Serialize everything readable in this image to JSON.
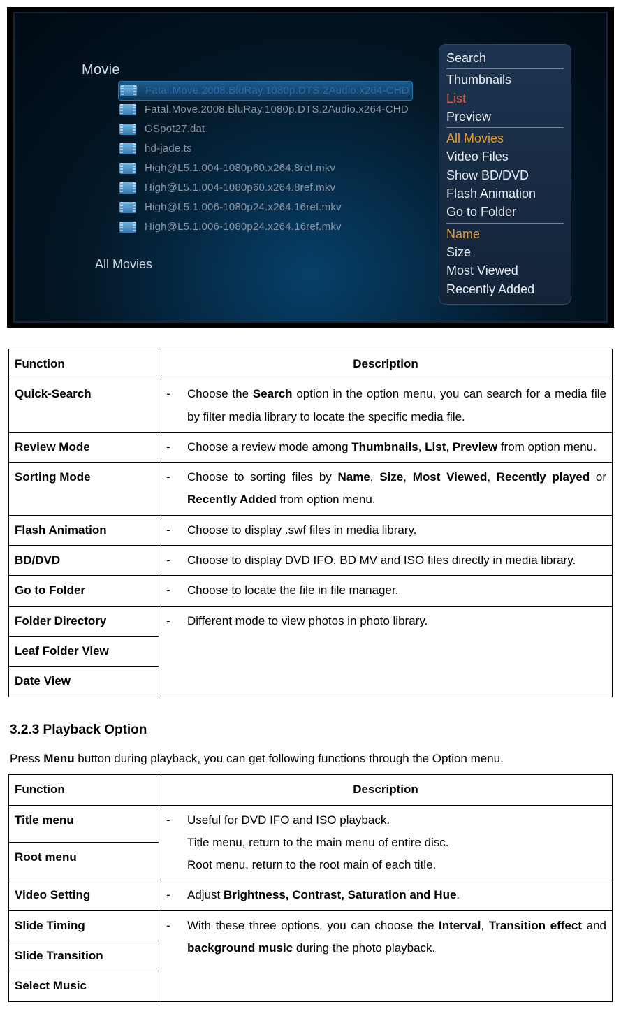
{
  "screenshot": {
    "section_label": "Movie",
    "status_label": "All Movies",
    "files": [
      {
        "name": "Fatal.Move.2008.BluRay.1080p.DTS.2Audio.x264-CHD",
        "selected": true
      },
      {
        "name": "Fatal.Move.2008.BluRay.1080p.DTS.2Audio.x264-CHD",
        "selected": false
      },
      {
        "name": "GSpot27.dat",
        "selected": false
      },
      {
        "name": "hd-jade.ts",
        "selected": false
      },
      {
        "name": "High@L5.1.004-1080p60.x264.8ref.mkv",
        "selected": false
      },
      {
        "name": "High@L5.1.004-1080p60.x264.8ref.mkv",
        "selected": false
      },
      {
        "name": "High@L5.1.006-1080p24.x264.16ref.mkv",
        "selected": false
      },
      {
        "name": "High@L5.1.006-1080p24.x264.16ref.mkv",
        "selected": false
      }
    ],
    "option_menu": [
      {
        "label": "Search",
        "style": "normal",
        "sep_after": true
      },
      {
        "label": "Thumbnails",
        "style": "normal",
        "sep_after": false
      },
      {
        "label": "List",
        "style": "red",
        "sep_after": false
      },
      {
        "label": "Preview",
        "style": "normal",
        "sep_after": true
      },
      {
        "label": "All Movies",
        "style": "hl",
        "sep_after": false
      },
      {
        "label": "Video Files",
        "style": "normal",
        "sep_after": false
      },
      {
        "label": "Show BD/DVD",
        "style": "normal",
        "sep_after": false
      },
      {
        "label": "Flash Animation",
        "style": "normal",
        "sep_after": false
      },
      {
        "label": "Go to Folder",
        "style": "normal",
        "sep_after": true
      },
      {
        "label": "Name",
        "style": "hl",
        "sep_after": false
      },
      {
        "label": "Size",
        "style": "normal",
        "sep_after": false
      },
      {
        "label": "Most Viewed",
        "style": "normal",
        "sep_after": false
      },
      {
        "label": "Recently Added",
        "style": "normal",
        "sep_after": false
      }
    ]
  },
  "table1": {
    "headers": {
      "c1": "Function",
      "c2": "Description"
    },
    "rows": [
      {
        "fn": "Quick-Search",
        "desc_html": "Choose the <span class='b'>Search</span> option in the option menu, you can search for a media file by filter media library to locate the specific media file."
      },
      {
        "fn": "Review Mode",
        "desc_html": "Choose a review mode among <span class='b'>Thumbnails</span>, <span class='b'>List</span>, <span class='b'>Preview</span> from option menu."
      },
      {
        "fn": "Sorting Mode",
        "desc_html": "Choose to sorting files by <span class='b'>Name</span>, <span class='b'>Size</span>, <span class='b'>Most Viewed</span>, <span class='b'>Recently played</span> or <span class='b'>Recently Added</span> from option menu."
      },
      {
        "fn": "Flash Animation",
        "desc_html": "Choose to display .swf files in media library."
      },
      {
        "fn": "BD/DVD",
        "desc_html": "Choose to display DVD IFO, BD MV and ISO files directly in media library."
      },
      {
        "fn": "Go to Folder",
        "desc_html": "Choose to locate the file in file manager."
      }
    ],
    "merged_group": {
      "fns": [
        "Folder Directory",
        "Leaf Folder View",
        "Date View"
      ],
      "desc_html": "Different mode to view photos in photo library."
    }
  },
  "section_heading": "3.2.3 Playback Option",
  "section_lead_html": "Press <span class='b'>Menu</span> button during playback, you can get following functions through the Option menu.",
  "table2": {
    "headers": {
      "c1": "Function",
      "c2": "Description"
    },
    "group1": {
      "fns": [
        "Title menu",
        "Root menu"
      ],
      "lines": [
        "Useful for DVD IFO and ISO playback.",
        "Title menu, return to the main menu of entire disc.",
        "Root menu, return to the root main of each title."
      ]
    },
    "row_video": {
      "fn": "Video Setting",
      "desc_html": "Adjust <span class='b'>Brightness, Contrast, Saturation and Hue</span>."
    },
    "group2": {
      "fns": [
        "Slide Timing",
        "Slide Transition",
        "Select Music"
      ],
      "desc_html": "With these three options, you can choose the <span class='b'>Interval</span>, <span class='b'>Transition effect</span> and <span class='b'>background music</span> during the photo playback."
    }
  }
}
